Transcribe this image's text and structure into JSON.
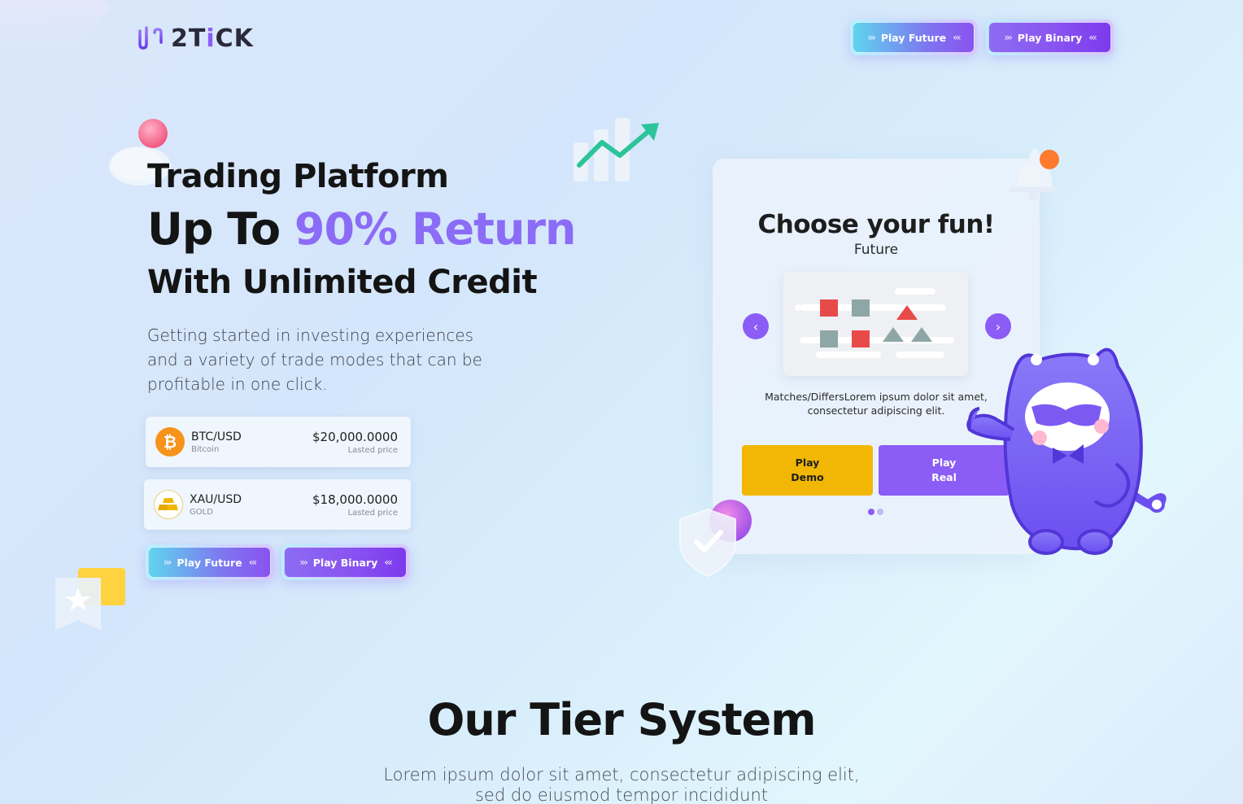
{
  "header": {
    "logo_text_prefix": "2T",
    "logo_text_i": "i",
    "logo_text_suffix": "CK",
    "play_future_label": "Play Future",
    "play_binary_label": "Play Binary"
  },
  "hero": {
    "line1": "Trading Platform",
    "line2_prefix": "Up To ",
    "line2_accent": "90% Return",
    "line3": "With Unlimited Credit",
    "description": "Getting started in investing experiences and a variety of trade modes that can be profitable in one click.",
    "tickers": [
      {
        "pair": "BTC/USD",
        "name": "Bitcoin",
        "price": "$20,000.0000",
        "price_label": "Lasted price",
        "icon": "bitcoin-icon"
      },
      {
        "pair": "XAU/USD",
        "name": "GOLD",
        "price": "$18,000.0000",
        "price_label": "Lasted price",
        "icon": "gold-bars-icon"
      }
    ],
    "play_future_label": "Play Future",
    "play_binary_label": "Play Binary"
  },
  "panel": {
    "title": "Choose your fun!",
    "subtitle": "Future",
    "description_line1": "Matches/DiffersLorem ipsum dolor sit amet,",
    "description_line2": "consectetur adipiscing elit.",
    "play_demo_line1": "Play",
    "play_demo_line2": "Demo",
    "play_real_line1": "Play",
    "play_real_line2": "Real",
    "prev_icon": "chevron-left-icon",
    "next_icon": "chevron-right-icon"
  },
  "tier": {
    "title": "Our Tier System",
    "description_line1": "Lorem ipsum dolor sit amet, consectetur adipiscing elit,",
    "description_line2": "sed do eiusmod tempor incididunt"
  },
  "colors": {
    "accent": "#8b5cf6",
    "demo_button": "#f2b705",
    "bitcoin": "#f7931a"
  }
}
